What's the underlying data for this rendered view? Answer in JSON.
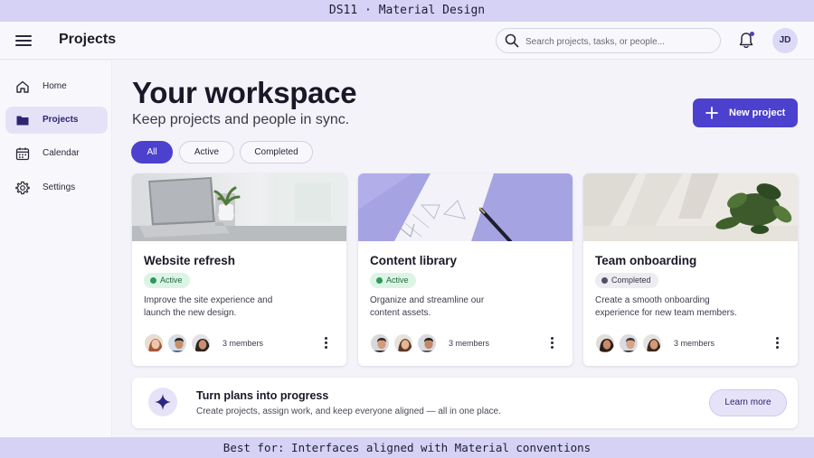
{
  "banner": {
    "top": "DS11 · Material Design",
    "bottom": "Best for: Interfaces aligned with Material conventions"
  },
  "appbar": {
    "title": "Projects",
    "search_placeholder": "Search projects, tasks, or people...",
    "avatar_initials": "JD",
    "notification_dot": true
  },
  "sidebar": {
    "items": [
      {
        "label": "Home",
        "icon": "home-icon",
        "active": false
      },
      {
        "label": "Projects",
        "icon": "folder-icon",
        "active": true
      },
      {
        "label": "Calendar",
        "icon": "calendar-icon",
        "active": false
      },
      {
        "label": "Settings",
        "icon": "gear-icon",
        "active": false
      }
    ]
  },
  "main": {
    "title": "Your workspace",
    "subtitle": "Keep projects and people in sync.",
    "new_button": "New project",
    "filters": [
      {
        "label": "All",
        "selected": true
      },
      {
        "label": "Active",
        "selected": false
      },
      {
        "label": "Completed",
        "selected": false
      }
    ],
    "cards": [
      {
        "title": "Website refresh",
        "status": "Active",
        "status_type": "active",
        "desc_line1": "Improve the site experience and",
        "desc_line2": "launch the new design.",
        "members": "3 members",
        "image": "laptop-on-desk"
      },
      {
        "title": "Content library",
        "status": "Active",
        "status_type": "active",
        "desc_line1": "Organize and streamline our",
        "desc_line2": "content assets.",
        "members": "3 members",
        "image": "notebook-and-pen"
      },
      {
        "title": "Team onboarding",
        "status": "Completed",
        "status_type": "completed",
        "desc_line1": "Create a smooth onboarding",
        "desc_line2": "experience for new team members.",
        "members": "3 members",
        "image": "plant-with-shadows"
      }
    ],
    "promo": {
      "title": "Turn plans into progress",
      "text": "Create projects, assign work, and keep everyone aligned — all in one place.",
      "button": "Learn more"
    }
  },
  "colors": {
    "primary": "#4c40cf",
    "active_bg": "#dcf4e6",
    "active_text": "#1f6b3b",
    "banner": "#d5d2f5"
  }
}
